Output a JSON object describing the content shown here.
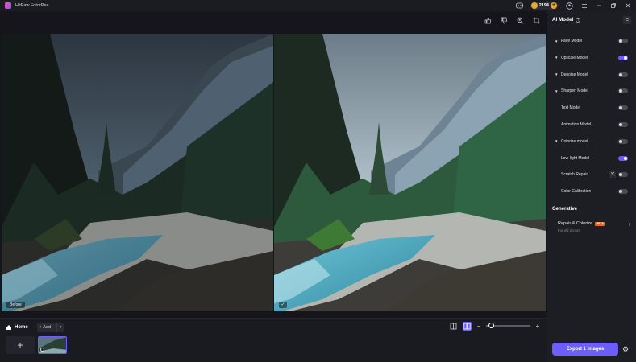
{
  "app": {
    "title": "HitPaw FotorPea"
  },
  "credits": {
    "count": "2194"
  },
  "canvas": {
    "before_label": "Before"
  },
  "bottom": {
    "home_label": "Home",
    "add_label": "Add"
  },
  "sidebar": {
    "title": "AI Model",
    "models": [
      {
        "label": "Face Model",
        "on": false,
        "expandable": true
      },
      {
        "label": "Upscale Model",
        "on": true,
        "expandable": true
      },
      {
        "label": "Denoise Model",
        "on": false,
        "expandable": true
      },
      {
        "label": "Sharpen Model",
        "on": false,
        "expandable": true
      },
      {
        "label": "Text Model",
        "on": false,
        "expandable": false
      },
      {
        "label": "Animation Model",
        "on": false,
        "expandable": false
      },
      {
        "label": "Colorize model",
        "on": false,
        "expandable": true
      },
      {
        "label": "Low-light Model",
        "on": true,
        "expandable": false
      },
      {
        "label": "Scratch Repair",
        "on": false,
        "expandable": false
      },
      {
        "label": "Color Calibration",
        "on": false,
        "expandable": false
      }
    ],
    "generative_title": "Generative",
    "repair_title": "Repair & Colorize",
    "repair_badge": "BETA",
    "repair_subtitle": "For old photos",
    "export_label": "Export 1 images"
  }
}
